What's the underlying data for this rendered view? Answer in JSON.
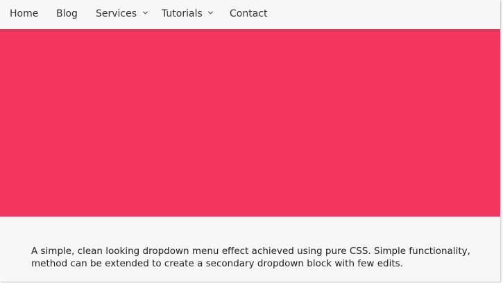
{
  "nav": {
    "items": [
      {
        "label": "Home"
      },
      {
        "label": "Blog"
      },
      {
        "label": "Services",
        "icon": "chevron-down-icon"
      },
      {
        "label": "Tutorials",
        "icon": "chevron-down-icon"
      },
      {
        "label": "Contact"
      }
    ]
  },
  "hero": {
    "color": "#f2365e"
  },
  "content": {
    "text": "A simple, clean looking dropdown menu effect achieved using pure CSS. Simple functionality, method can be extended to create a secondary dropdown block with few edits."
  }
}
